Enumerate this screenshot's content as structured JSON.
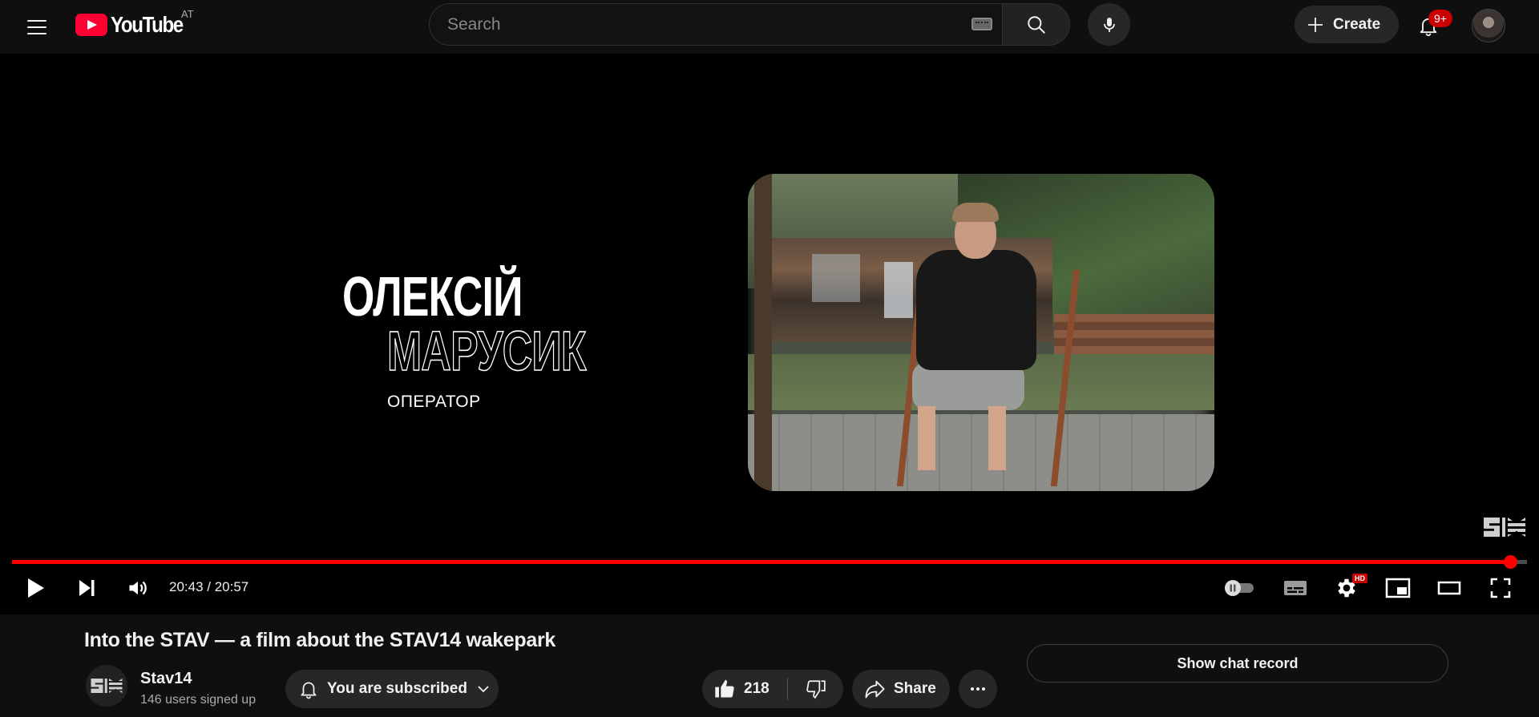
{
  "masthead": {
    "logo_text": "YouTube",
    "country_code": "AT",
    "search": {
      "placeholder": "Search",
      "value": ""
    },
    "create_label": "Create",
    "notification_count": "9+"
  },
  "player": {
    "overlay": {
      "first_name": "ОЛЕКСІЙ",
      "last_name": "МАРУСИК",
      "role": "ОПЕРАТОР"
    },
    "time": "20:43 / 20:57",
    "progress_fraction": 0.9887,
    "settings_badge": "HD",
    "accent_color": "#ff0000"
  },
  "video": {
    "title": "Into the STAV — a film about the STAV14 wakepark",
    "channel": {
      "name": "Stav14",
      "subscribers": "146 users signed up"
    },
    "subscribe_label": "You are subscribed",
    "like_count": "218",
    "share_label": "Share",
    "chat_record_label": "Show chat record"
  },
  "icons": {
    "menu": "menu-icon",
    "search": "search-icon",
    "mic": "mic-icon",
    "keyboard": "keyboard-icon",
    "plus": "plus-icon",
    "bell": "bell-icon",
    "play": "play-icon",
    "next": "next-icon",
    "volume": "volume-icon",
    "autoplay": "autoplay-toggle-icon",
    "subtitles": "subtitles-icon",
    "settings": "gear-icon",
    "miniplayer": "miniplayer-icon",
    "theater": "theater-icon",
    "fullscreen": "fullscreen-icon",
    "like": "thumbs-up-icon",
    "dislike": "thumbs-down-icon",
    "share": "share-icon",
    "more": "more-horizontal-icon",
    "chevron": "chevron-down-icon"
  }
}
